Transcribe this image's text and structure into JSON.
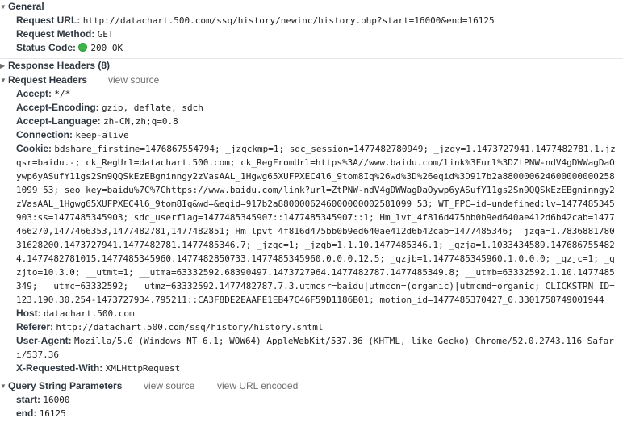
{
  "general": {
    "title": "General",
    "request_url_key": "Request URL:",
    "request_url_value": "http://datachart.500.com/ssq/history/newinc/history.php?start=16000&end=16125",
    "request_method_key": "Request Method:",
    "request_method_value": "GET",
    "status_code_key": "Status Code:",
    "status_code_value": "200 OK",
    "status_color": "#3cb44a"
  },
  "response_headers": {
    "title": "Response Headers (8)"
  },
  "request_headers": {
    "title": "Request Headers",
    "view_source": "view source",
    "items": [
      {
        "key": "Accept:",
        "value": "*/*"
      },
      {
        "key": "Accept-Encoding:",
        "value": "gzip, deflate, sdch"
      },
      {
        "key": "Accept-Language:",
        "value": "zh-CN,zh;q=0.8"
      },
      {
        "key": "Connection:",
        "value": "keep-alive"
      },
      {
        "key": "Cookie:",
        "value": "bdshare_firstime=1476867554794; _jzqckmp=1; sdc_session=1477482780949; _jzqy=1.1473727941.1477482781.1.jzqsr=baidu.-; ck_RegUrl=datachart.500.com; ck_RegFromUrl=https%3A//www.baidu.com/link%3Furl%3DZtPNW-ndV4gDWWagDaOywp6yASufY11gs2Sn9QQSkEzEBgninngy2zVasAAL_1Hgwg65XUFPXEC4l6_9tom8Iq%26wd%3D%26eqid%3D917b2a8800006246000000002581099 53; seo_key=baidu%7C%7Chttps://www.baidu.com/link?url=ZtPNW-ndV4gDWWagDaOywp6yASufY11gs2Sn9QQSkEzEBgninngy2zVasAAL_1Hgwg65XUFPXEC4l6_9tom8Iq&wd=&eqid=917b2a8800006246000000002581099 53; WT_FPC=id=undefined:lv=1477485345903:ss=1477485345903; sdc_userflag=1477485345907::1477485345907::1; Hm_lvt_4f816d475bb0b9ed640ae412d6b42cab=1477466270,1477466353,1477482781,1477482851; Hm_lpvt_4f816d475bb0b9ed640ae412d6b42cab=1477485346; _jzqa=1.783688178031628200.1473727941.1477482781.1477485346.7; _jzqc=1; _jzqb=1.1.10.1477485346.1; _qzja=1.1033434589.1476867554824.1477482781015.1477485345960.1477482850733.1477485345960.0.0.0.12.5; _qzjb=1.1477485345960.1.0.0.0; _qzjc=1; _qzjto=10.3.0; __utmt=1; __utma=63332592.68390497.1473727964.1477482787.1477485349.8; __utmb=63332592.1.10.1477485349; __utmc=63332592; __utmz=63332592.1477482787.7.3.utmcsr=baidu|utmccn=(organic)|utmcmd=organic; CLICKSTRN_ID=123.190.30.254-1473727934.795211::CA3F8DE2EAAFE1EB47C46F59D1186B01; motion_id=1477485370427_0.3301758749001944"
      },
      {
        "key": "Host:",
        "value": "datachart.500.com"
      },
      {
        "key": "Referer:",
        "value": "http://datachart.500.com/ssq/history/history.shtml"
      },
      {
        "key": "User-Agent:",
        "value": "Mozilla/5.0 (Windows NT 6.1; WOW64) AppleWebKit/537.36 (KHTML, like Gecko) Chrome/52.0.2743.116 Safari/537.36"
      },
      {
        "key": "X-Requested-With:",
        "value": "XMLHttpRequest"
      }
    ]
  },
  "query_params": {
    "title": "Query String Parameters",
    "view_source": "view source",
    "view_url_encoded": "view URL encoded",
    "items": [
      {
        "key": "start:",
        "value": "16000"
      },
      {
        "key": "end:",
        "value": "16125"
      }
    ]
  }
}
